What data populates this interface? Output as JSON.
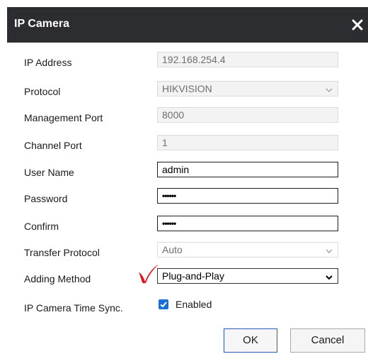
{
  "dialog": {
    "title": "IP Camera"
  },
  "fields": {
    "ip_address": {
      "label": "IP Address",
      "value": "192.168.254.4"
    },
    "protocol": {
      "label": "Protocol",
      "value": "HIKVISION"
    },
    "management_port": {
      "label": "Management Port",
      "value": "8000"
    },
    "channel_port": {
      "label": "Channel Port",
      "value": "1"
    },
    "user_name": {
      "label": "User Name",
      "value": "admin"
    },
    "password": {
      "label": "Password",
      "value": "••••••"
    },
    "confirm": {
      "label": "Confirm",
      "value": "••••••"
    },
    "transfer_protocol": {
      "label": "Transfer Protocol",
      "value": "Auto"
    },
    "adding_method": {
      "label": "Adding Method",
      "value": "Plug-and-Play"
    },
    "time_sync": {
      "label": "IP Camera Time Sync.",
      "option_label": "Enabled",
      "checked": true
    }
  },
  "buttons": {
    "ok": "OK",
    "cancel": "Cancel"
  },
  "colors": {
    "titlebar": "#2b2d31",
    "checkbox": "#1a6fd6",
    "annotation": "#e0141a"
  },
  "icons": [
    "close-icon",
    "chevron-down-icon",
    "checkmark-icon",
    "red-checkmark-annotation"
  ]
}
